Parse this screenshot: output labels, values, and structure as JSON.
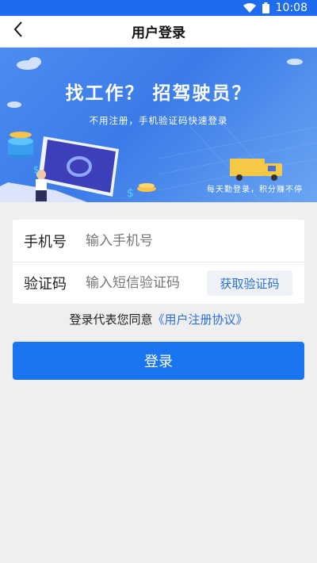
{
  "status_bar": {
    "time": "10:08",
    "icons": [
      "wifi-icon",
      "battery-icon"
    ]
  },
  "nav": {
    "back_icon": "chevron-left-icon",
    "title": "用户登录"
  },
  "banner": {
    "headline": "找工作？ 招驾驶员？",
    "subtitle": "不用注册，手机验证码快速登录",
    "tagline": "每天勤登录，积分赚不停"
  },
  "form": {
    "phone_label": "手机号",
    "phone_placeholder": "输入手机号",
    "code_label": "验证码",
    "code_placeholder": "输入短信验证码",
    "get_code_label": "获取验证码"
  },
  "agreement": {
    "prefix": "登录代表您同意",
    "link": "《用户注册协议》"
  },
  "login_label": "登录",
  "colors": {
    "primary": "#1a75f0",
    "link": "#2a6fd9",
    "background": "#efefef",
    "status_bar": "#1e6bf0"
  }
}
